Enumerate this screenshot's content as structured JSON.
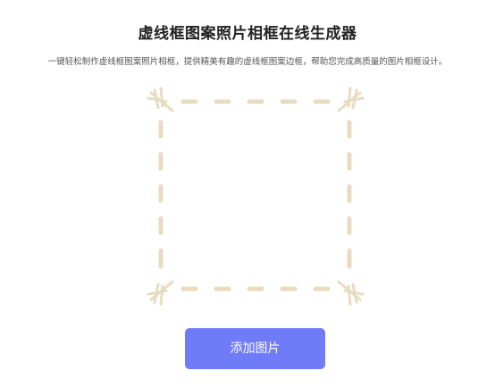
{
  "header": {
    "title": "虚线框图案照片相框在线生成器",
    "subtitle": "一键轻松制作虚线框图案照片相框，提供精美有趣的虚线框图案边框，帮助您完成高质量的图片相框设计。"
  },
  "preview": {
    "frame_style": "dashed-stitch",
    "frame_color": "#e8dcc0",
    "corner_icon": "stitch-cross-icon"
  },
  "actions": {
    "add_image_label": "添加图片",
    "button_color": "#6f7bf7"
  }
}
